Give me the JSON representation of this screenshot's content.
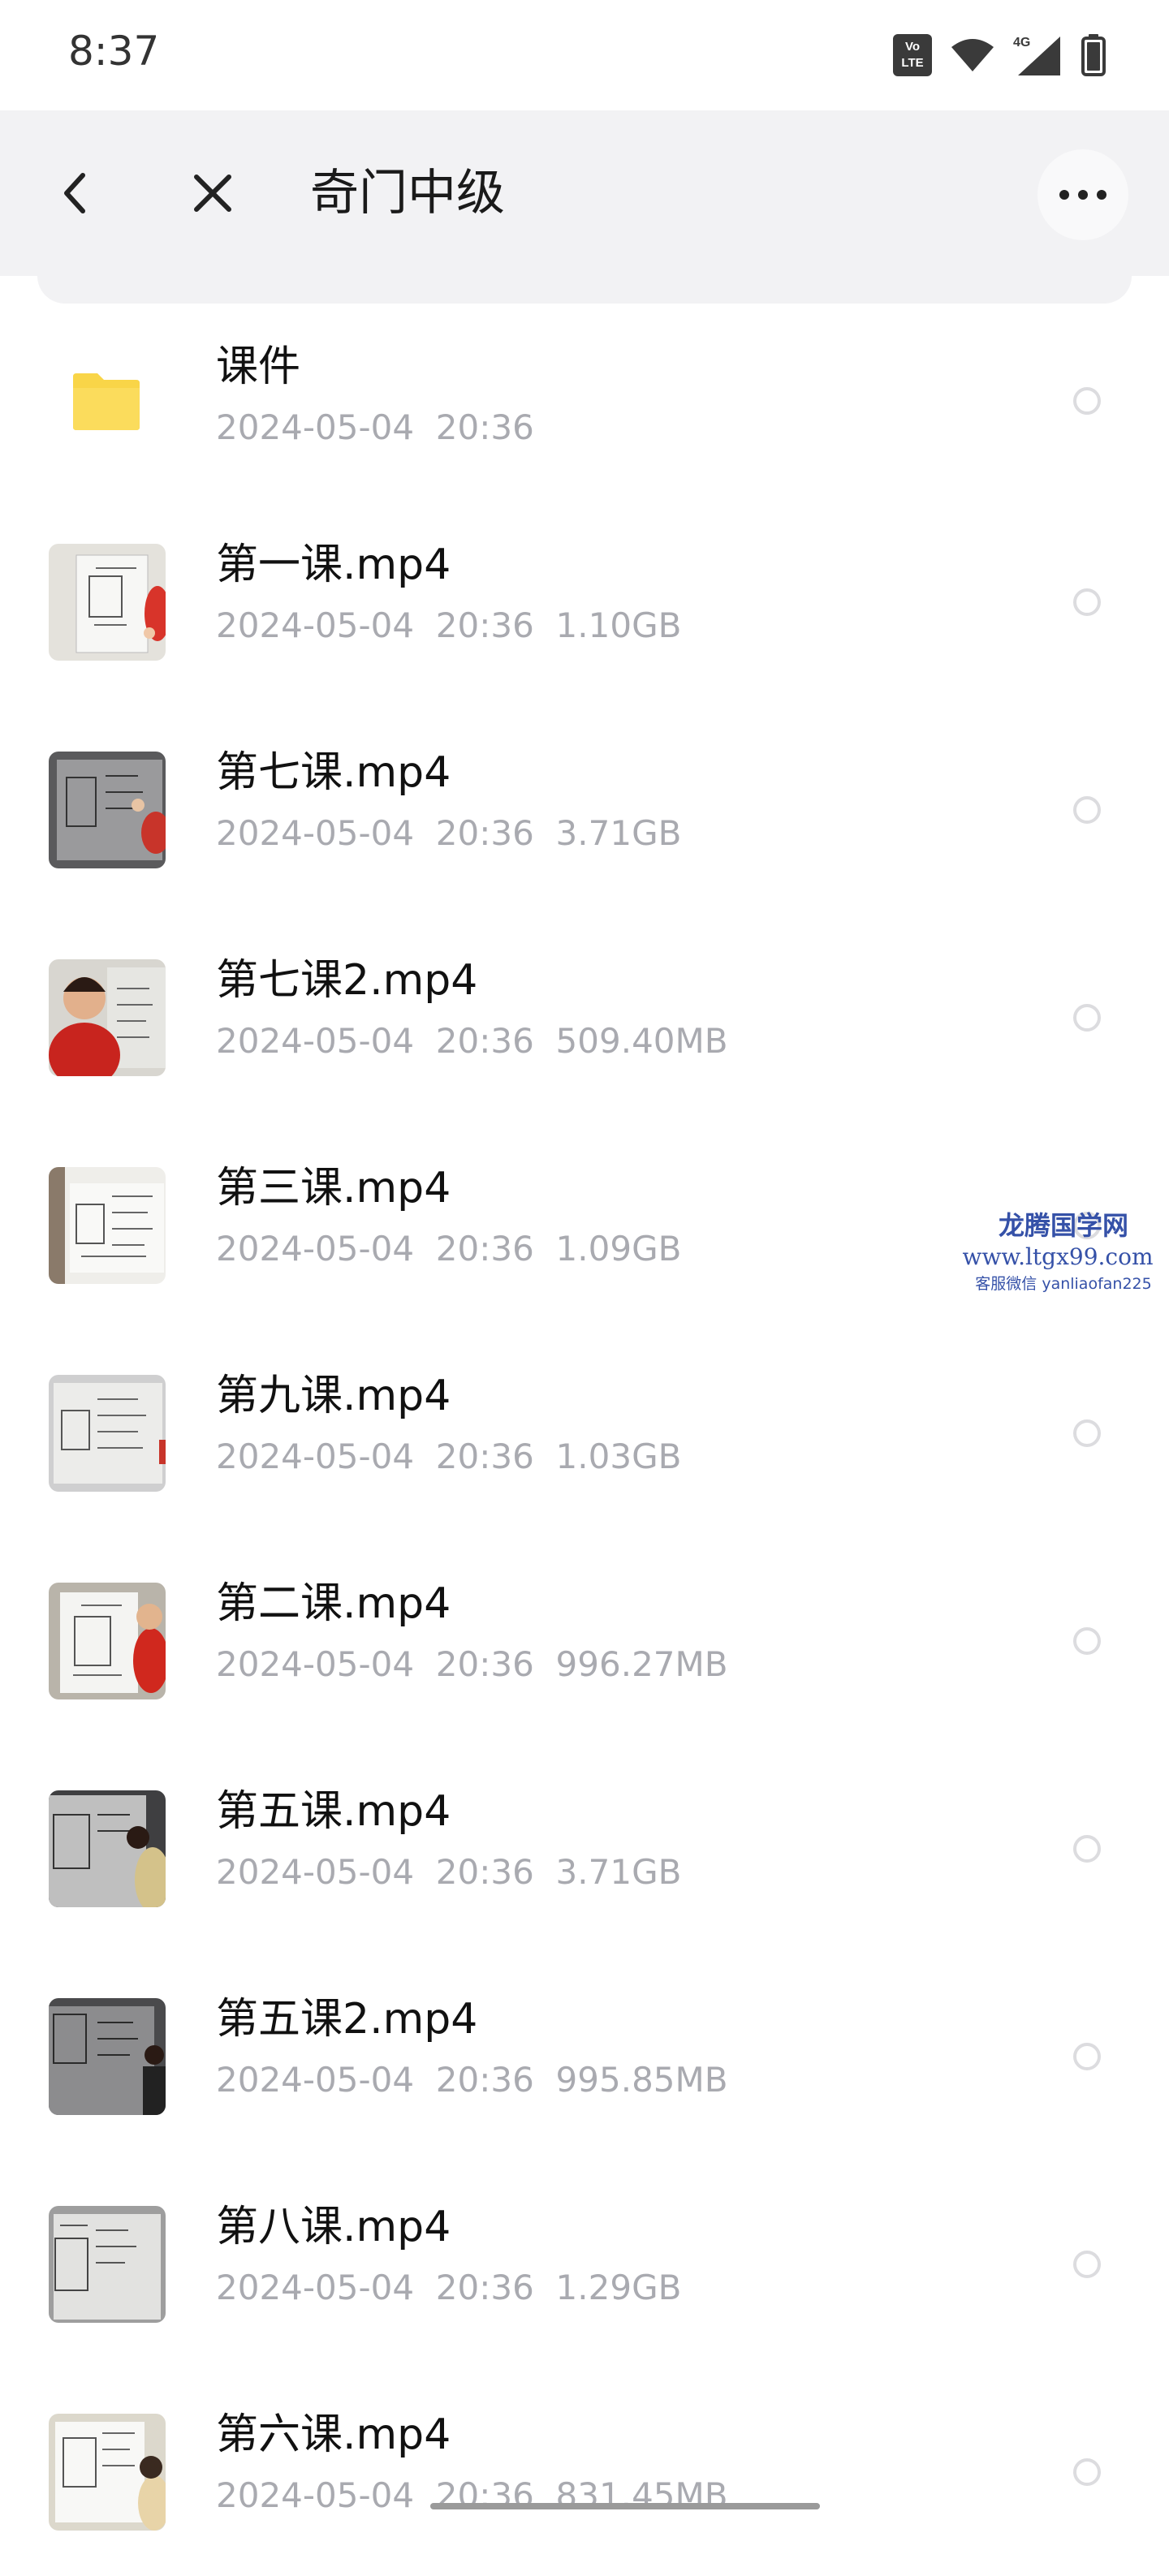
{
  "status_bar": {
    "time": "8:37",
    "volte_badge": "Vo LTE",
    "network_label": "4G",
    "icons": [
      "volte-icon",
      "wifi-icon",
      "signal-4g-icon",
      "battery-icon"
    ]
  },
  "header": {
    "title": "奇门中级",
    "icons": [
      "back-icon",
      "close-icon",
      "more-icon"
    ]
  },
  "files": [
    {
      "name": "课件",
      "date": "2024-05-04",
      "time": "20:36",
      "size": "",
      "type": "folder"
    },
    {
      "name": "第一课.mp4",
      "date": "2024-05-04",
      "time": "20:36",
      "size": "1.10GB",
      "type": "video"
    },
    {
      "name": "第七课.mp4",
      "date": "2024-05-04",
      "time": "20:36",
      "size": "3.71GB",
      "type": "video"
    },
    {
      "name": "第七课2.mp4",
      "date": "2024-05-04",
      "time": "20:36",
      "size": "509.40MB",
      "type": "video"
    },
    {
      "name": "第三课.mp4",
      "date": "2024-05-04",
      "time": "20:36",
      "size": "1.09GB",
      "type": "video"
    },
    {
      "name": "第九课.mp4",
      "date": "2024-05-04",
      "time": "20:36",
      "size": "1.03GB",
      "type": "video"
    },
    {
      "name": "第二课.mp4",
      "date": "2024-05-04",
      "time": "20:36",
      "size": "996.27MB",
      "type": "video"
    },
    {
      "name": "第五课.mp4",
      "date": "2024-05-04",
      "time": "20:36",
      "size": "3.71GB",
      "type": "video"
    },
    {
      "name": "第五课2.mp4",
      "date": "2024-05-04",
      "time": "20:36",
      "size": "995.85MB",
      "type": "video"
    },
    {
      "name": "第八课.mp4",
      "date": "2024-05-04",
      "time": "20:36",
      "size": "1.29GB",
      "type": "video"
    },
    {
      "name": "第六课.mp4",
      "date": "2024-05-04",
      "time": "20:36",
      "size": "831.45MB",
      "type": "video"
    }
  ],
  "watermark": {
    "line1": "龙腾国学网",
    "line2": "www.ltgx99.com",
    "line3": "客服微信 yanliaofan225"
  },
  "colors": {
    "header_bg": "#f2f2f4",
    "meta_text": "#a9aab0",
    "folder": "#f9d548",
    "watermark": "#3551a8"
  }
}
